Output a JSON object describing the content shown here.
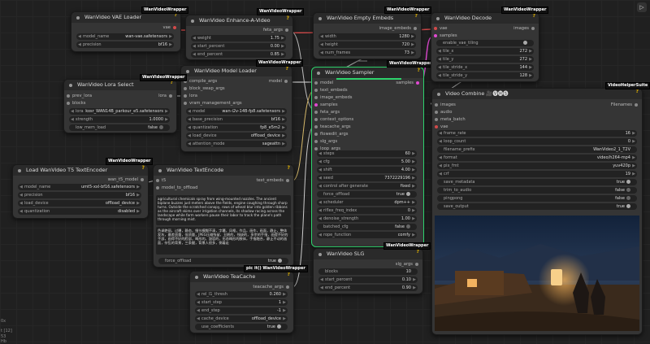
{
  "wrapper_badge": "WanVideoWrapper",
  "helper_badge": "VideoHelperSuite",
  "misc_badge": "pic it() WanVideoWrapper",
  "canvas_left_labels": [
    "0x",
    "t [12]",
    "53",
    "Hb"
  ],
  "vae_loader": {
    "title": "WanVideo VAE Loader",
    "output": "vae",
    "widgets": [
      {
        "label": "model_name",
        "value": "wan-vae.safetensors"
      },
      {
        "label": "precision",
        "value": "bf16"
      }
    ]
  },
  "enhance": {
    "title": "WanVideo Enhance-A-Video",
    "output": "feta_args",
    "widgets": [
      {
        "label": "weight",
        "value": "1.75"
      },
      {
        "label": "start_percent",
        "value": "0.00"
      },
      {
        "label": "end_percent",
        "value": "0.85"
      }
    ]
  },
  "model_loader": {
    "title": "WanVideo Model Loader",
    "inputs": [
      "compile_args",
      "block_swap_args",
      "lora",
      "vram_management_args"
    ],
    "output": "model",
    "widgets": [
      {
        "label": "model",
        "value": "wan-i2v-14B-fp8.safetensors"
      },
      {
        "label": "base_precision",
        "value": "bf16"
      },
      {
        "label": "quantization",
        "value": "fp8_e5m2"
      },
      {
        "label": "load_device",
        "value": "offload_device"
      },
      {
        "label": "attention_mode",
        "value": "sageattn"
      }
    ]
  },
  "lora": {
    "title": "WanVideo Lora Select",
    "inputs": [
      "prev_lora",
      "blocks"
    ],
    "output": "lora",
    "widgets": [
      {
        "label": "lora",
        "value": "kosr_WAN14B_parkour_e5.safetensors"
      },
      {
        "label": "strength",
        "value": "1.0000"
      },
      {
        "label": "low_mem_load",
        "value": "false"
      }
    ]
  },
  "empty_embeds": {
    "title": "WanVideo Empty Embeds",
    "output": "image_embeds",
    "widgets": [
      {
        "label": "width",
        "value": "1280"
      },
      {
        "label": "height",
        "value": "720"
      },
      {
        "label": "num_frames",
        "value": "73"
      }
    ]
  },
  "sampler": {
    "title": "WanVideo Sampler",
    "inputs": [
      "model",
      "text_embeds",
      "image_embeds",
      "samples",
      "feta_args",
      "context_options",
      "teacache_args",
      "flowedit_args",
      "slg_args",
      "loop_args"
    ],
    "output": "samples",
    "widgets": [
      {
        "label": "steps",
        "value": "60"
      },
      {
        "label": "cfg",
        "value": "5.00"
      },
      {
        "label": "shift",
        "value": "4.00"
      },
      {
        "label": "seed",
        "value": "7372229196"
      },
      {
        "label": "control after generate",
        "value": "fixed"
      },
      {
        "label": "force_offload",
        "value": "true"
      },
      {
        "label": "scheduler",
        "value": "dpm++"
      },
      {
        "label": "riflex_freq_index",
        "value": "0"
      },
      {
        "label": "denoise_strength",
        "value": "1.00"
      },
      {
        "label": "batched_cfg",
        "value": "false"
      },
      {
        "label": "rope_function",
        "value": "comfy"
      }
    ]
  },
  "decode": {
    "title": "WanVideo Decode",
    "inputs": [
      "vae",
      "samples"
    ],
    "output": "images",
    "widgets": [
      {
        "label": "enable_vae_tiling",
        "value": ""
      },
      {
        "label": "tile_x",
        "value": "272"
      },
      {
        "label": "tile_y",
        "value": "272"
      },
      {
        "label": "tile_stride_x",
        "value": "144"
      },
      {
        "label": "tile_stride_y",
        "value": "128"
      }
    ]
  },
  "t5": {
    "title": "Load WanVideo T5 TextEncoder",
    "output": "wan_t5_model",
    "widgets": [
      {
        "label": "model_name",
        "value": "umt5-xxl-bf16.safetensors"
      },
      {
        "label": "precision",
        "value": "bf16"
      },
      {
        "label": "load_device",
        "value": "offload_device"
      },
      {
        "label": "quantization",
        "value": "disabled"
      }
    ]
  },
  "text_encode": {
    "title": "WanVideo TextEncode",
    "inputs": [
      "t5",
      "model_to_offload"
    ],
    "output": "text_embeds",
    "positive_prompt": "agricultural chemicals spray from wing-mounted nozzles. The ancient biplane buzzes just meters above the fields, engine coughing through sharp turns. Outside the scratched canopy, rows of wheat blur into golden ribbons as the aircraft skims over irrigation channels, its shadow racing across the landscape while farm workers pause their labor to track the plane's path through morning mist.",
    "negative_prompt": "色调艳丽，过曝，静态，细节模糊不清，字幕，风格，作品，画作，画面，静止，整体发灰，最差质量，低质量，JPEG压缩残留，丑陋的，残缺的，多余的手指，画得不好的手部，画得不好的脸部，畸形的，毁容的，形态畸形的肢体，手指融合，静止不动的画面，杂乱的背景，三条腿，背景人很多，倒着走",
    "force_offload_label": "force_offload",
    "force_offload_value": "true"
  },
  "slg": {
    "title": "WanVideo SLG",
    "output": "slg_args",
    "widgets": [
      {
        "label": "blocks",
        "value": "10"
      },
      {
        "label": "start_percent",
        "value": "0.10"
      },
      {
        "label": "end_percent",
        "value": "0.90"
      }
    ]
  },
  "teacache": {
    "title": "WanVideo TeaCache",
    "output": "teacache_args",
    "widgets": [
      {
        "label": "rel_l1_thresh",
        "value": "0.260"
      },
      {
        "label": "start_step",
        "value": "1"
      },
      {
        "label": "end_step",
        "value": "-1"
      },
      {
        "label": "cache_device",
        "value": "offload_device"
      },
      {
        "label": "use_coefficients",
        "value": "true"
      }
    ]
  },
  "combine": {
    "title": "Video Combine 🎥🅥🅗🅢",
    "inputs": [
      "images",
      "audio",
      "meta_batch",
      "vae"
    ],
    "output": "Filenames",
    "widgets": [
      {
        "label": "frame_rate",
        "value": "16"
      },
      {
        "label": "loop_count",
        "value": "0"
      },
      {
        "label": "filename_prefix",
        "value": "WanVideo2_1_T2V"
      },
      {
        "label": "format",
        "value": "video/h264-mp4"
      },
      {
        "label": "pix_fmt",
        "value": "yuv420p"
      },
      {
        "label": "crf",
        "value": "19"
      },
      {
        "label": "save_metadata",
        "value": "true"
      },
      {
        "label": "trim_to_audio",
        "value": "false"
      },
      {
        "label": "pingpong",
        "value": "false"
      },
      {
        "label": "save_output",
        "value": "true"
      }
    ]
  },
  "colors": {
    "selected_border": "#2ed26c",
    "link_red": "#d24a4a",
    "link_pink": "#e04ad2",
    "link_white": "#cccccc"
  }
}
